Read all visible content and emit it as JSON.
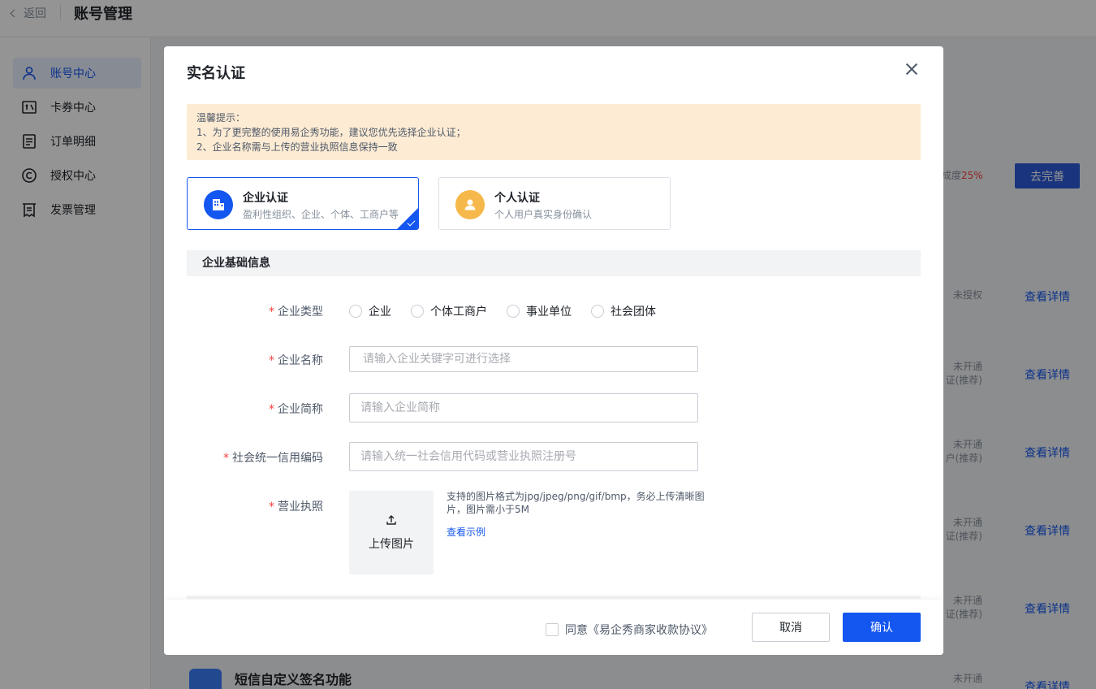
{
  "page": {
    "back_label": "返回",
    "title": "账号管理"
  },
  "sidebar": {
    "items": [
      {
        "label": "账号中心",
        "icon": "user-icon",
        "active": true
      },
      {
        "label": "卡券中心",
        "icon": "coupon-icon"
      },
      {
        "label": "订单明细",
        "icon": "order-list-icon"
      },
      {
        "label": "授权中心",
        "icon": "copyright-icon"
      },
      {
        "label": "发票管理",
        "icon": "invoice-icon"
      }
    ]
  },
  "background": {
    "completion_prefix": "成度",
    "completion_value": "25%",
    "complete_button": "去完善",
    "rows": [
      {
        "status": "未授权",
        "status2": "",
        "link": "查看详情"
      },
      {
        "status": "未开通",
        "status2": "证(推荐)",
        "link": "查看详情"
      },
      {
        "status": "未开通",
        "status2": "户(推荐)",
        "link": "查看详情"
      },
      {
        "status": "未开通",
        "status2": "证(推荐)",
        "link": "查看详情"
      },
      {
        "status": "未开通",
        "status2": "证(推荐)",
        "link": "查看详情"
      },
      {
        "status": "未开通",
        "status2": "",
        "link": "查看详情"
      }
    ],
    "card_title": "短信自定义签名功能"
  },
  "modal": {
    "title": "实名认证",
    "tip": {
      "heading": "温馨提示：",
      "line1": "1、为了更完整的使用易企秀功能，建议您优先选择企业认证；",
      "line2": "2、企业名称需与上传的营业执照信息保持一致"
    },
    "auth_options": [
      {
        "title": "企业认证",
        "desc": "盈利性组织、企业、个体、工商户等",
        "selected": true
      },
      {
        "title": "个人认证",
        "desc": "个人用户真实身份确认",
        "selected": false
      }
    ],
    "section_title": "企业基础信息",
    "form": {
      "type_label": "企业类型",
      "type_options": [
        "企业",
        "个体工商户",
        "事业单位",
        "社会团体"
      ],
      "name_label": "企业名称",
      "name_placeholder": "请输入企业关键字可进行选择",
      "short_label": "企业简称",
      "short_placeholder": "请输入企业简称",
      "credit_label": "社会统一信用编码",
      "credit_placeholder": "请输入统一社会信用代码或营业执照注册号",
      "license_label": "营业执照",
      "upload_label": "上传图片",
      "upload_hint": "支持的图片格式为jpg/jpeg/png/gif/bmp，务必上传清晰图片，图片需小于5M",
      "example_link": "查看示例"
    },
    "footer": {
      "agree_text": "同意《易企秀商家收款协议》",
      "cancel": "取消",
      "confirm": "确认"
    }
  },
  "colors": {
    "primary": "#1456f0",
    "tip_bg": "#fdebd3",
    "required": "#f53f3f",
    "enterprise_icon": "#1456f0",
    "personal_icon": "#f7b84b"
  }
}
